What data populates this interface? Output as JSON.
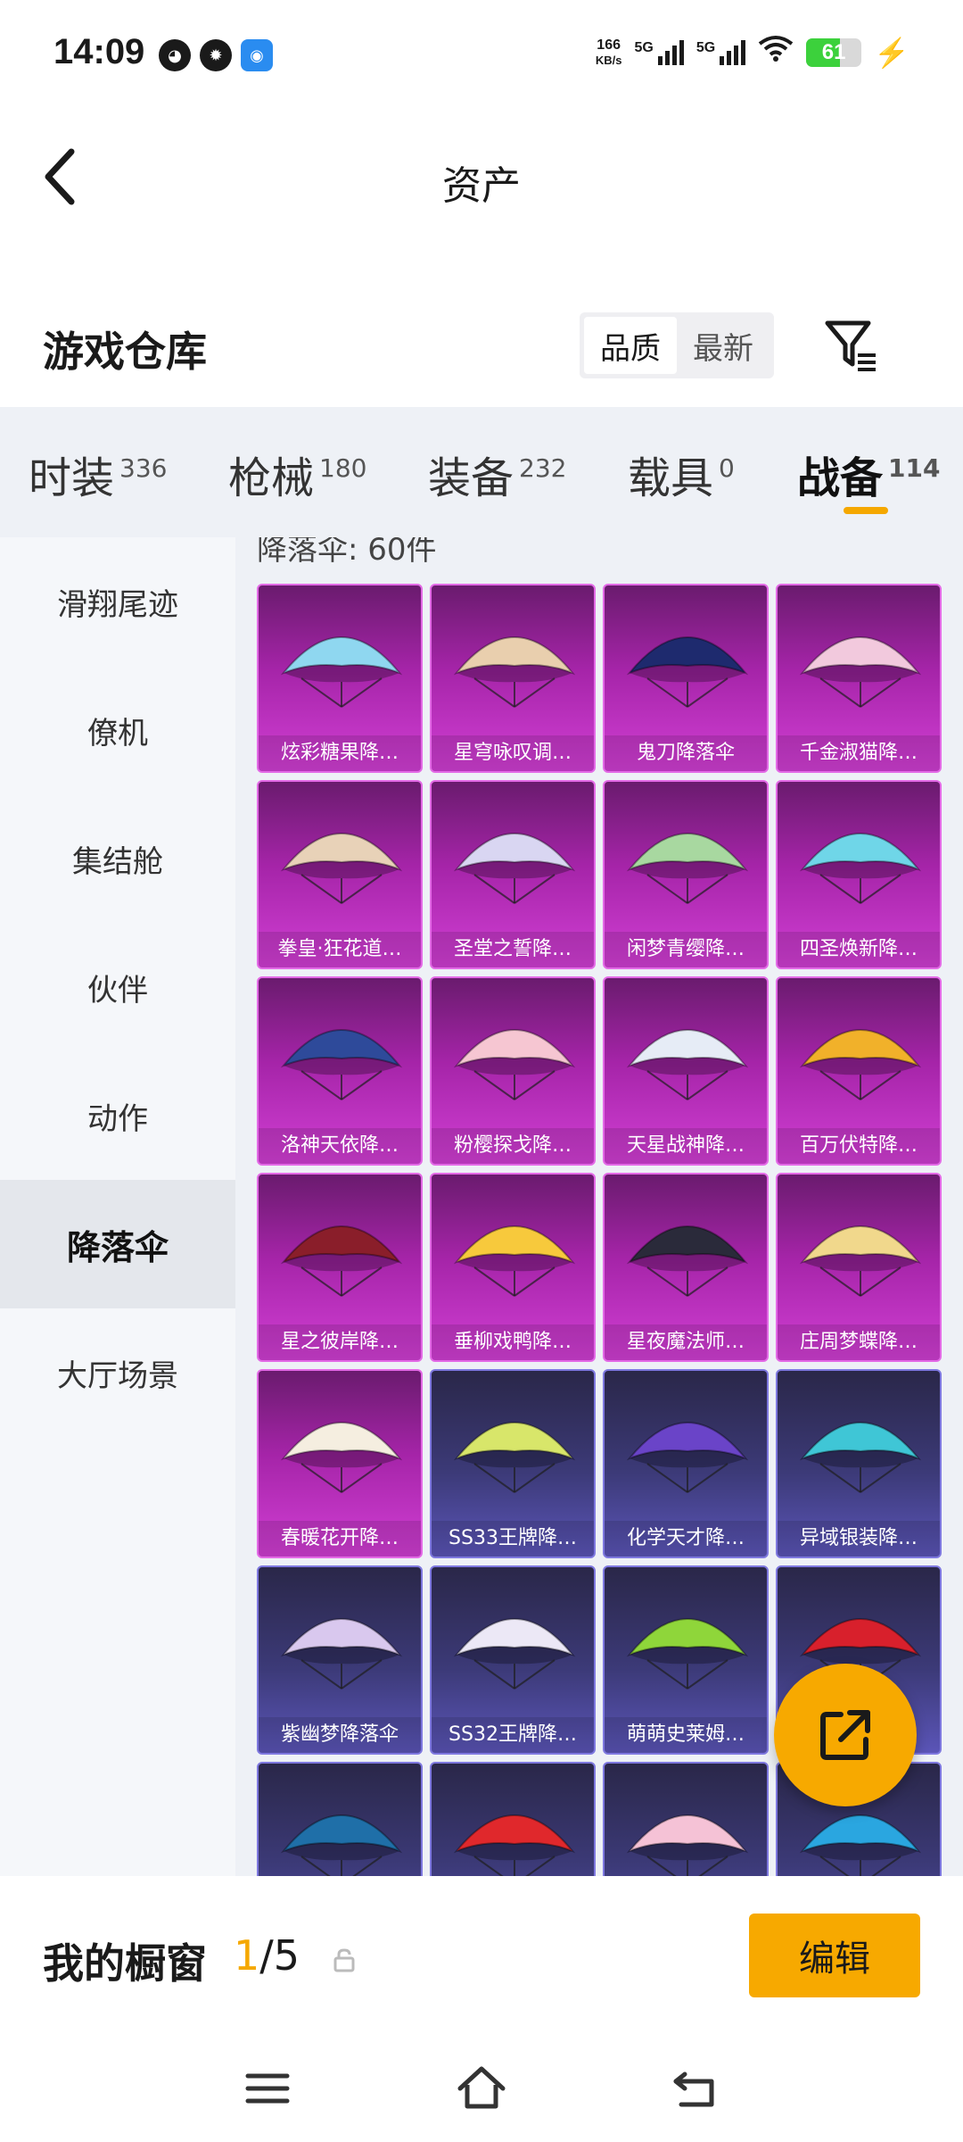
{
  "status_bar": {
    "time": "14:09",
    "net_speed_value": "166",
    "net_speed_unit": "KB/s",
    "sim1_label": "5G",
    "sim2_label": "5G",
    "battery_level": "61",
    "battery_fill": 0.61
  },
  "header": {
    "title": "资产"
  },
  "warehouse": {
    "title": "游戏仓库",
    "sort_options": [
      "品质",
      "最新"
    ],
    "sort_selected": "品质"
  },
  "tabs": [
    {
      "label": "时装",
      "count": "336"
    },
    {
      "label": "枪械",
      "count": "180"
    },
    {
      "label": "装备",
      "count": "232"
    },
    {
      "label": "载具",
      "count": "0"
    },
    {
      "label": "战备",
      "count": "114",
      "active": true
    }
  ],
  "sidebar": {
    "items": [
      "滑翔尾迹",
      "僚机",
      "集结舱",
      "伙伴",
      "动作",
      "降落伞",
      "大厅场景"
    ],
    "active": "降落伞"
  },
  "grid": {
    "count_label": "降落伞: 60件",
    "items": [
      {
        "name": "炫彩糖果降…",
        "tier": "pink",
        "color": "#8fd7f0"
      },
      {
        "name": "星穹咏叹调…",
        "tier": "pink",
        "color": "#e9cfae"
      },
      {
        "name": "鬼刀降落伞",
        "tier": "pink",
        "color": "#1e2a6e"
      },
      {
        "name": "千金淑猫降…",
        "tier": "pink",
        "color": "#f2c9dd"
      },
      {
        "name": "拳皇·狂花道…",
        "tier": "pink",
        "color": "#e8d2b8"
      },
      {
        "name": "圣堂之誓降…",
        "tier": "pink",
        "color": "#d9d6f2"
      },
      {
        "name": "闲梦青缨降…",
        "tier": "pink",
        "color": "#a8d8a0"
      },
      {
        "name": "四圣焕新降…",
        "tier": "pink",
        "color": "#6fd6e8"
      },
      {
        "name": "洛神天依降…",
        "tier": "pink",
        "color": "#2e4a9a"
      },
      {
        "name": "粉樱探戈降…",
        "tier": "pink",
        "color": "#f6c6d2"
      },
      {
        "name": "天星战神降…",
        "tier": "pink",
        "color": "#e6ecf6"
      },
      {
        "name": "百万伏特降…",
        "tier": "pink",
        "color": "#f1b12a"
      },
      {
        "name": "星之彼岸降…",
        "tier": "pink",
        "color": "#8a1e2a"
      },
      {
        "name": "垂柳戏鸭降…",
        "tier": "pink",
        "color": "#f7c93c"
      },
      {
        "name": "星夜魔法师…",
        "tier": "pink",
        "color": "#2a2a3a"
      },
      {
        "name": "庄周梦蝶降…",
        "tier": "pink",
        "color": "#f1d88c"
      },
      {
        "name": "春暖花开降…",
        "tier": "pink",
        "color": "#f5eee0"
      },
      {
        "name": "SS33王牌降…",
        "tier": "blue",
        "color": "#d8e66a"
      },
      {
        "name": "化学天才降…",
        "tier": "blue",
        "color": "#6a44c8"
      },
      {
        "name": "异域银装降…",
        "tier": "blue",
        "color": "#3fc6d6"
      },
      {
        "name": "紫幽梦降落伞",
        "tier": "blue",
        "color": "#d9c8ee"
      },
      {
        "name": "SS32王牌降…",
        "tier": "blue",
        "color": "#ece8f6"
      },
      {
        "name": "萌萌史莱姆…",
        "tier": "blue",
        "color": "#8fd63a"
      },
      {
        "name": "",
        "tier": "blue",
        "color": "#d8202c"
      },
      {
        "name": "",
        "tier": "blue",
        "color": "#1f6fa8"
      },
      {
        "name": "",
        "tier": "blue",
        "color": "#e0282c"
      },
      {
        "name": "",
        "tier": "blue",
        "color": "#f5c2d6"
      },
      {
        "name": "",
        "tier": "blue",
        "color": "#2aa6e0"
      }
    ]
  },
  "showcase": {
    "label": "我的橱窗",
    "current": "1",
    "separator_total": "/5",
    "edit_label": "编辑"
  },
  "icons": {
    "back": "chevron-left-icon",
    "filter": "filter-icon",
    "share": "share-icon",
    "lock": "lock-icon",
    "nav_menu": "menu-icon",
    "nav_home": "home-icon",
    "nav_back": "back-arrow-icon"
  },
  "colors": {
    "accent": "#f7a900",
    "legendary_card": "#d13fd4",
    "epic_card": "#5b55b8"
  }
}
